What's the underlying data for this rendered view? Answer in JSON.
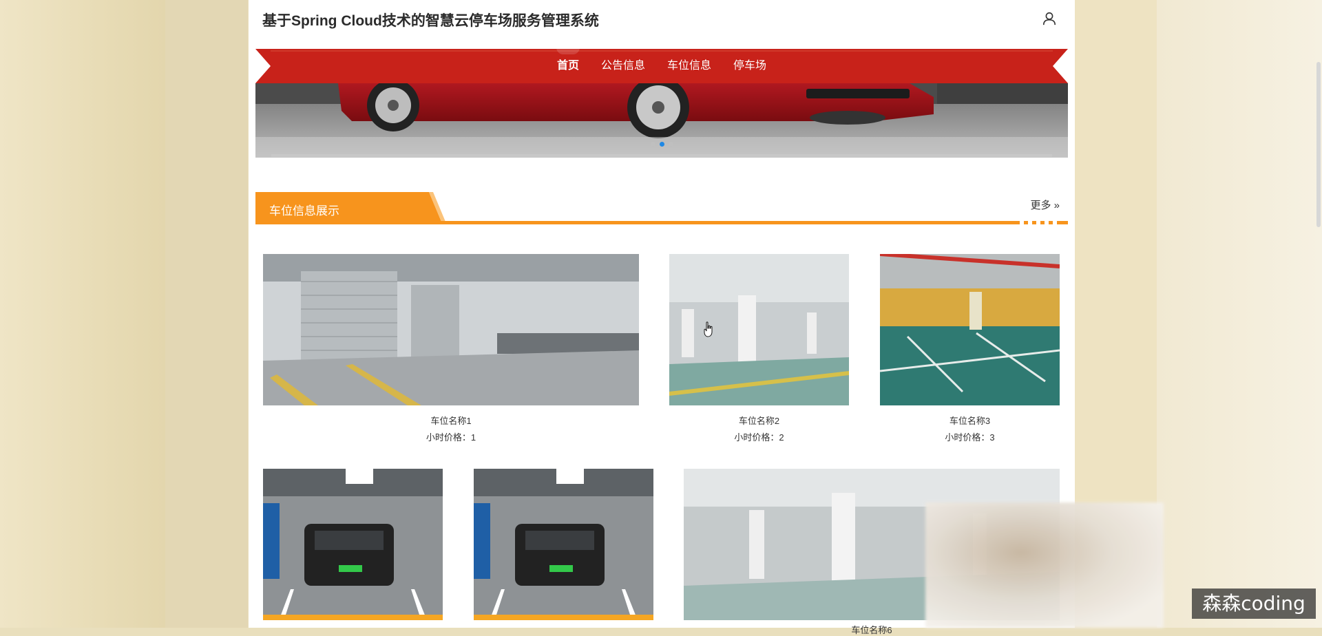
{
  "header": {
    "title": "基于Spring Cloud技术的智慧云停车场服务管理系统",
    "user_icon": "user-icon"
  },
  "nav": {
    "items": [
      "首页",
      "公告信息",
      "车位信息",
      "停车场"
    ],
    "active_index": 0
  },
  "banner": {
    "dots": 3,
    "active_dot": 1
  },
  "section": {
    "title": "车位信息展示",
    "more_label": "更多"
  },
  "cards": [
    {
      "name": "车位名称1",
      "price": "小时价格：1"
    },
    {
      "name": "车位名称2",
      "price": "小时价格：2"
    },
    {
      "name": "车位名称3",
      "price": "小时价格：3"
    }
  ],
  "partial_label": "车位名称6",
  "watermark": "森森coding",
  "colors": {
    "nav_red": "#c8221a",
    "section_orange": "#f7941d",
    "accent_blue": "#1e88e5"
  }
}
